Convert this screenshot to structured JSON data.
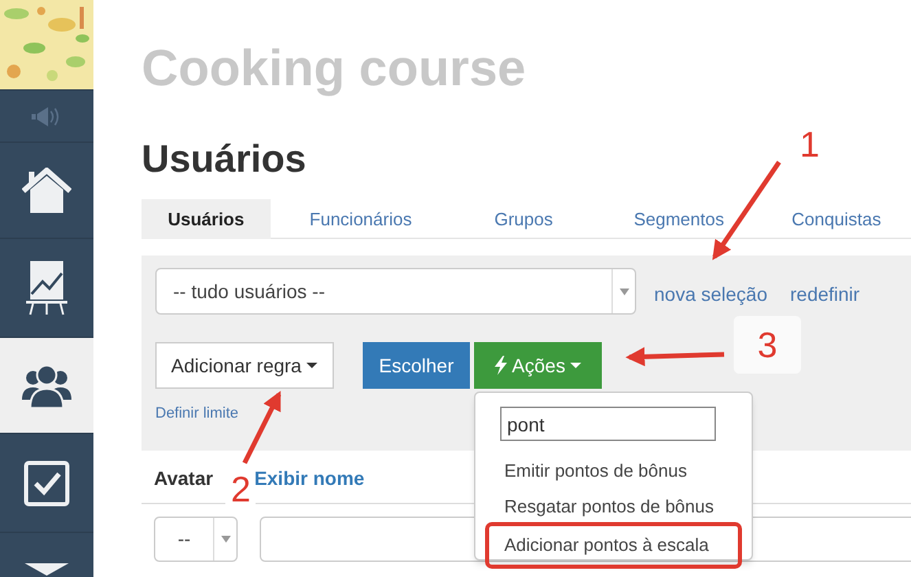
{
  "sidebar": {
    "items": [
      {
        "kind": "speaker",
        "selected": false
      },
      {
        "kind": "home",
        "selected": false
      },
      {
        "kind": "chart",
        "selected": false
      },
      {
        "kind": "users",
        "selected": true
      },
      {
        "kind": "check",
        "selected": false
      },
      {
        "kind": "mail",
        "selected": false
      }
    ]
  },
  "course_title": "Cooking course",
  "page_title": "Usuários",
  "tabs": [
    {
      "label": "Usuários",
      "selected": true
    },
    {
      "label": "Funcionários",
      "selected": false
    },
    {
      "label": "Grupos",
      "selected": false
    },
    {
      "label": "Segmentos",
      "selected": false
    },
    {
      "label": "Conquistas",
      "selected": false
    }
  ],
  "filter": {
    "select_value": "-- tudo usuários --",
    "links": [
      "nova seleção",
      "redefinir"
    ],
    "add_rule_button": "Adicionar regra",
    "limit_link": "Definir limite",
    "choose_button": "Escolher",
    "actions_button": "Ações"
  },
  "actions_menu": {
    "search_value": "pont",
    "items": [
      {
        "label": "Emitir pontos de bônus",
        "circled": false
      },
      {
        "label": "Resgatar pontos de bônus",
        "circled": false
      },
      {
        "label": "Adicionar pontos à escala",
        "circled": true
      }
    ]
  },
  "table": {
    "columns": [
      {
        "label": "Avatar",
        "sortable": false
      },
      {
        "label": "Exibir nome",
        "sortable": true
      }
    ],
    "filter_row": {
      "select_value": "--"
    }
  },
  "annotations": [
    {
      "label": "1"
    },
    {
      "label": "2"
    },
    {
      "label": "3"
    }
  ]
}
